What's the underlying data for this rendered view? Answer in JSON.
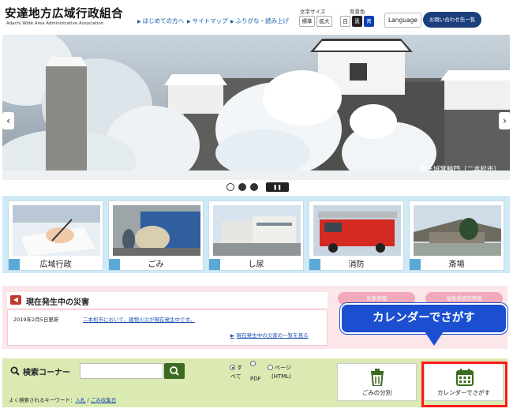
{
  "header": {
    "logo_jp": "安達地方広域行政組合",
    "logo_en": "Adachi Wide Area Administrative Association",
    "nav": [
      "はじめての方へ",
      "サイトマップ",
      "ふりがな・読み上げ"
    ],
    "font_size_label": "文字サイズ",
    "font_size_options": [
      "標準",
      "拡大"
    ],
    "bg_color_label": "背景色",
    "bg_color_options": [
      "白",
      "黒",
      "青"
    ],
    "language_label": "Language",
    "contact_label": "お問い合わせ先一覧"
  },
  "hero": {
    "caption": "霞ヶ城箕輪門（二本松市）",
    "stop_label": "Stop",
    "prev_icon": "chevron-left-icon",
    "next_icon": "chevron-right-icon",
    "dot_colors": [
      "#ffffff",
      "#333333",
      "#333333"
    ]
  },
  "categories": [
    {
      "label": "広域行政",
      "icon": "writing-hand-image"
    },
    {
      "label": "ごみ",
      "icon": "garbage-truck-image"
    },
    {
      "label": "し尿",
      "icon": "treatment-plant-image"
    },
    {
      "label": "消防",
      "icon": "fire-engine-image"
    },
    {
      "label": "斎場",
      "icon": "crematorium-image"
    }
  ],
  "disaster": {
    "title": "現在発生中の災害",
    "date": "2019年2月5日更新",
    "news": "二本松市において、建物火災が現在発生中です。",
    "more": "現在発生中の災害の一覧を見る",
    "buttons": [
      "気象情報",
      "福島県病院情報"
    ]
  },
  "callout": {
    "text": "カレンダーでさがす"
  },
  "search": {
    "title": "検索コーナー",
    "input_value": "",
    "options": [
      "すべて",
      "PDF",
      "ページ(HTML)"
    ],
    "option_lines": {
      "all": [
        "す",
        "べて"
      ],
      "html": [
        "ページ",
        "(HTML)"
      ]
    },
    "frequent_label": "よく検索されるキーワード：",
    "frequent_keywords": [
      "入札",
      "ごみ収集日"
    ],
    "separator": "/",
    "buttons": [
      "ごみの分別",
      "カレンダーでさがす"
    ]
  },
  "colors": {
    "brand": "#1b3f7a",
    "accent_red": "#ff1a1a",
    "callout_blue": "#1b4fd0",
    "search_bg": "#dbe9b3",
    "category_bg": "#cfeaf6",
    "disaster_bg": "#fbe6ea"
  }
}
